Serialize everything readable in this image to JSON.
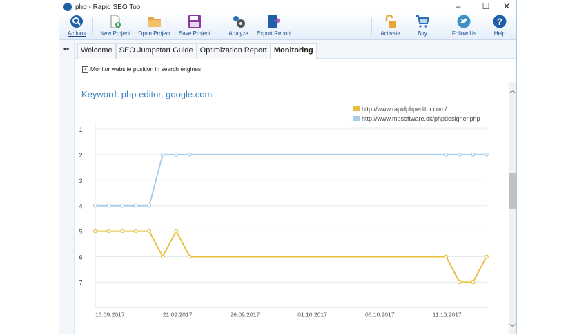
{
  "window": {
    "title": "php - Rapid SEO Tool",
    "minimize": "–",
    "maximize": "☐",
    "close": "✕"
  },
  "toolbar": {
    "actions": "Actions",
    "new_project": "New Project",
    "open_project": "Open Project",
    "save_project": "Save Project",
    "analyze": "Analyze",
    "export_report": "Export Report",
    "activate": "Activate",
    "buy": "Buy",
    "follow_us": "Follow Us",
    "help": "Help"
  },
  "sidebar_toggle": "▸▸",
  "tabs": [
    {
      "label": "Welcome"
    },
    {
      "label": "SEO Jumpstart Guide"
    },
    {
      "label": "Optimization Report"
    },
    {
      "label": "Monitoring"
    }
  ],
  "monitor_checkbox": {
    "label": "Monitor website position in search engines",
    "checked": true
  },
  "chart_data": {
    "type": "line",
    "title": "Keyword: php editor, google.com",
    "x_start": "16.09.2017",
    "x_days": [
      0,
      1,
      2,
      3,
      4,
      5,
      6,
      7,
      26,
      27,
      28,
      29
    ],
    "x_tick_labels": [
      {
        "day": 0,
        "label": "16.09.2017"
      },
      {
        "day": 5,
        "label": "21.09.2017"
      },
      {
        "day": 10,
        "label": "26.09.2017"
      },
      {
        "day": 15,
        "label": "01.10.2017"
      },
      {
        "day": 20,
        "label": "06.10.2017"
      },
      {
        "day": 25,
        "label": "11.10.2017"
      }
    ],
    "y_ticks": [
      1,
      2,
      3,
      4,
      5,
      6,
      7
    ],
    "ylim": [
      1,
      8
    ],
    "y_inverted": true,
    "legend_position": "top-right",
    "series": [
      {
        "name": "http://www.rapidphpeditor.com/",
        "color": "#e8bf3e",
        "values": [
          5,
          5,
          5,
          5,
          5,
          6,
          5,
          6,
          6,
          7,
          7,
          6
        ]
      },
      {
        "name": "http://www.mpsoftware.dk/phpdesigner.php",
        "color": "#a7cde8",
        "values": [
          4,
          4,
          4,
          4,
          4,
          2,
          2,
          2,
          2,
          2,
          2,
          2
        ]
      }
    ]
  }
}
